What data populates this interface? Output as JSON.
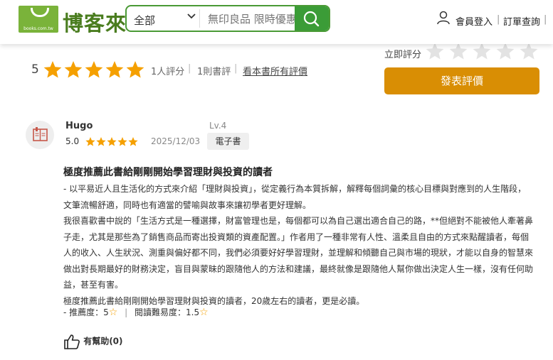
{
  "header": {
    "logo_url": "books.com.tw",
    "logo_text": "博客來",
    "search_category": "全部",
    "search_placeholder": "無印良品 限時優惠",
    "member_login": "會員登入",
    "order_query": "訂單查詢",
    "colors": {
      "brand_green": "#4a9a35"
    }
  },
  "summary": {
    "average": "5",
    "stars": 5,
    "raters": "1人評分",
    "reviews": "1則書評",
    "all_reviews_link": "看本書所有評價",
    "rate_now_label": "立即評分",
    "post_review_button": "發表評價",
    "colors": {
      "star": "#f5a000",
      "button": "#d98e04"
    }
  },
  "review": {
    "user": "Hugo",
    "level": "Lv.4",
    "score": "5.0",
    "stars": 5,
    "date": "2025/12/03",
    "tag": "電子書",
    "title": "極度推薦此書給剛剛開始學習理財與投資的讀者",
    "paragraphs": [
      "- 以平易近人且生活化的方式來介紹「理財與投資」，從定義行為本質拆解，解釋每個詞彙的核心目標與對應到的人生階段，文筆流暢舒適，同時也有適當的譬喻與故事來讓初學者更好理解。",
      "我很喜歡書中說的「生活方式是一種選擇，財富管理也是，每個都可以為自己選出適合自己的路，**但絕對不能被他人牽著鼻子走，尤其是那些為了銷售商品而寄出投資類的資產配置。」作者用了一種非常有人性、溫柔且自由的方式來點醒讀者，每個人的收入、人生狀況、測重與偏好都不同，我們必須要好好學習理財，並理解和傾聽自己與市場的現狀，才能以自身的智慧來做出對長期最好的財務決定，盲目與蒙昧的跟隨他人的方法和建議，最終就像是跟隨他人幫你做出決定人生一樣，沒有任何助益，甚至有害。",
      "極度推薦此書給剛剛開始學習理財與投資的讀者，20歲左右的讀者，更是必讀。"
    ],
    "recommend": "- 推薦度：5",
    "difficulty": "閱讀難易度：1.5",
    "helpful": "有幫助(0)"
  }
}
